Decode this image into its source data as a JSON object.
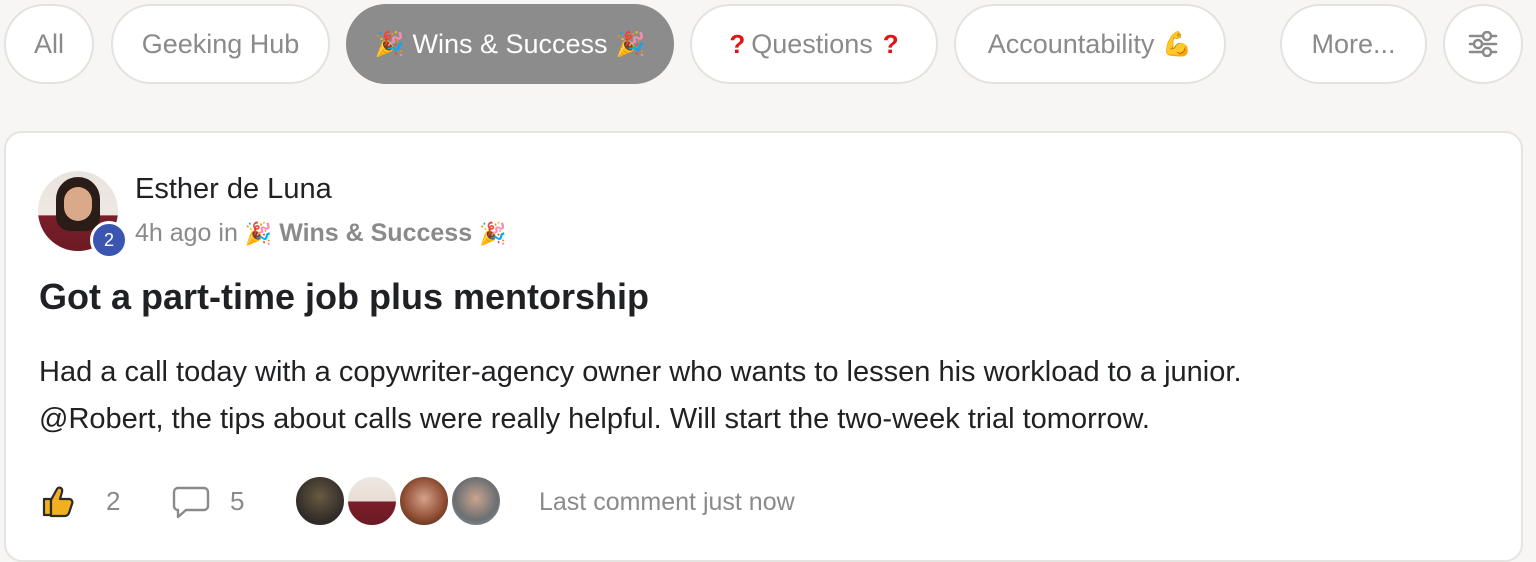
{
  "tabs": {
    "all": "All",
    "geeking_hub": "Geeking Hub",
    "wins_label": "Wins & Success",
    "wins_emoji": "🎉",
    "questions_label": "Questions",
    "questions_mark": "?",
    "accountability_label": "Accountability",
    "accountability_emoji": "💪",
    "more": "More...",
    "filter_icon": "sliders-icon",
    "active_tab": "Wins & Success"
  },
  "post": {
    "author": "Esther de Luna",
    "level_badge": "2",
    "time_ago": "4h ago in",
    "category": "Wins & Success",
    "category_emoji": "🎉",
    "title": "Got a part-time job plus mentorship",
    "body_line_1": "Had a call today with a copywriter-agency owner who wants to lessen his workload to a junior.",
    "body_line_2": "@Robert, the tips about calls were really helpful. Will start the two-week trial tomorrow.",
    "likes": "2",
    "comments": "5",
    "last_comment": "Last comment just now",
    "like_icon": "thumbs-up-icon",
    "comment_icon": "speech-bubble-icon"
  },
  "colors": {
    "active_pill": "#8c8c8c",
    "badge": "#3a56b0",
    "muted_text": "#8a8a8a",
    "like_yellow": "#f2b01e"
  }
}
